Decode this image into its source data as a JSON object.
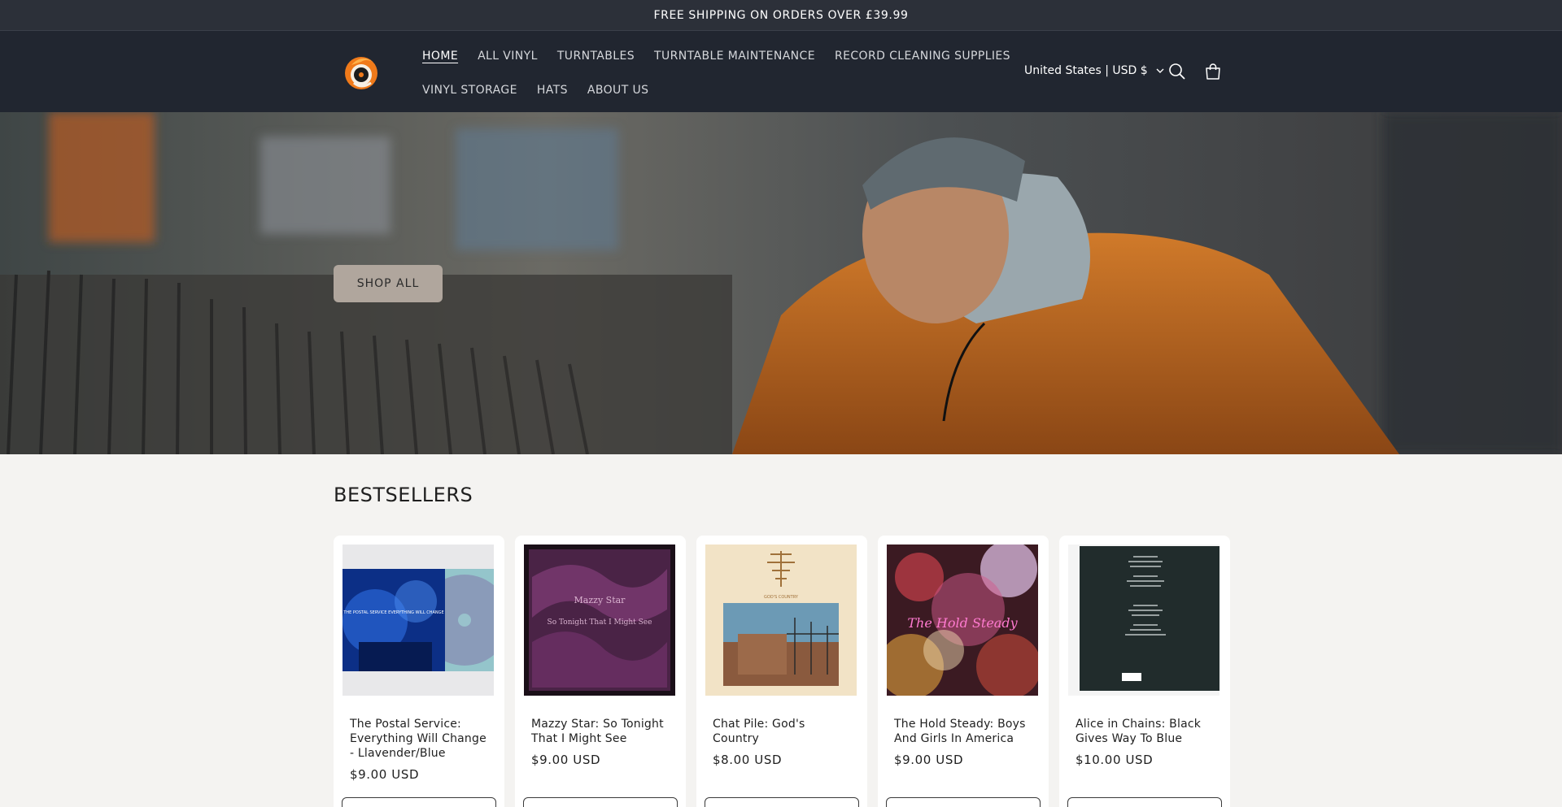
{
  "announcement": {
    "text": "FREE SHIPPING ON ORDERS OVER £39.99"
  },
  "header": {
    "nav_row1": [
      "HOME",
      "ALL VINYL",
      "TURNTABLES",
      "TURNTABLE MAINTENANCE",
      "RECORD CLEANING SUPPLIES"
    ],
    "nav_row2": [
      "VINYL STORAGE",
      "HATS",
      "ABOUT US"
    ],
    "active_item": "HOME",
    "country_selector": "United States | USD $",
    "icons": [
      "logo-icon",
      "chevron-down-icon",
      "search-icon",
      "cart-icon"
    ]
  },
  "hero": {
    "button_label": "SHOP ALL"
  },
  "bestsellers": {
    "title": "BESTSELLERS",
    "products": [
      {
        "title": "The Postal Service: Everything Will Change - Llavender/Blue",
        "price": "$9.00 USD",
        "cover_text": "THE POSTAL SERVICE EVERYTHING WILL CHANGE"
      },
      {
        "title": "Mazzy Star: So Tonight That I Might See",
        "price": "$9.00 USD",
        "cover_text": "Mazzy Star",
        "cover_subtext": "So Tonight That I Might See"
      },
      {
        "title": "Chat Pile: God's Country",
        "price": "$8.00 USD",
        "cover_text": "GOD'S COUNTRY"
      },
      {
        "title": "The Hold Steady: Boys And Girls In America",
        "price": "$9.00 USD",
        "cover_text": "The Hold Steady"
      },
      {
        "title": "Alice in Chains: Black Gives Way To Blue",
        "price": "$10.00 USD"
      }
    ]
  },
  "colors": {
    "announcement_bg": "#2c3039",
    "header_bg": "#212630",
    "hero_button_bg": "#b0a69d",
    "page_bg": "#f4f3f1",
    "logo_accent": "#f07a1a"
  }
}
